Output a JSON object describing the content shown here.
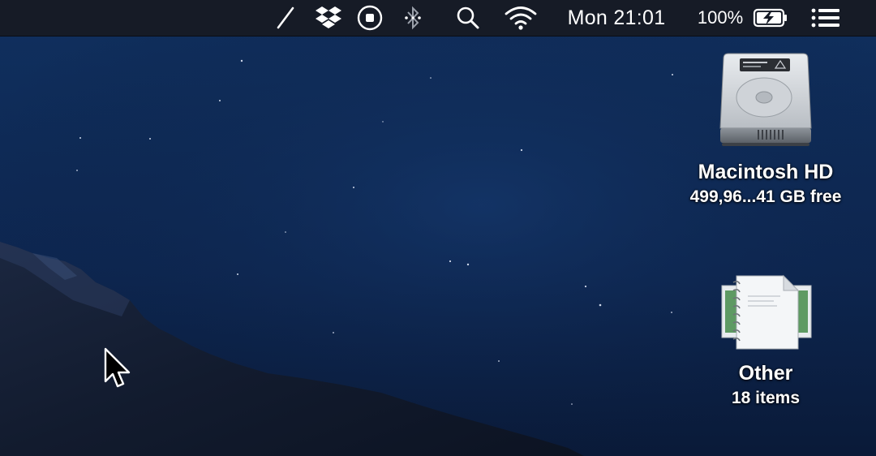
{
  "menubar": {
    "items": [
      {
        "icon": "pen-icon"
      },
      {
        "icon": "dropbox-icon"
      },
      {
        "icon": "stop-record-icon"
      },
      {
        "icon": "bluetooth-icon"
      },
      {
        "icon": "spotlight-search-icon"
      },
      {
        "icon": "wifi-icon"
      }
    ],
    "clock": "Mon 21:01",
    "battery_percent": "100%",
    "battery_icon": "battery-charging-icon",
    "menu_icon": "notification-center-icon"
  },
  "desktop": {
    "icons": [
      {
        "name": "Macintosh HD",
        "detail": "499,96...41 GB free",
        "icon": "hard-drive-icon"
      },
      {
        "name": "Other",
        "detail": "18 items",
        "icon": "documents-stack-icon"
      }
    ]
  },
  "colors": {
    "menubar_bg": "#161b26",
    "sky_top": "#0f2d5c",
    "sky_bottom": "#0b1a36",
    "mountain": "#121a2c",
    "text": "#ffffff"
  }
}
